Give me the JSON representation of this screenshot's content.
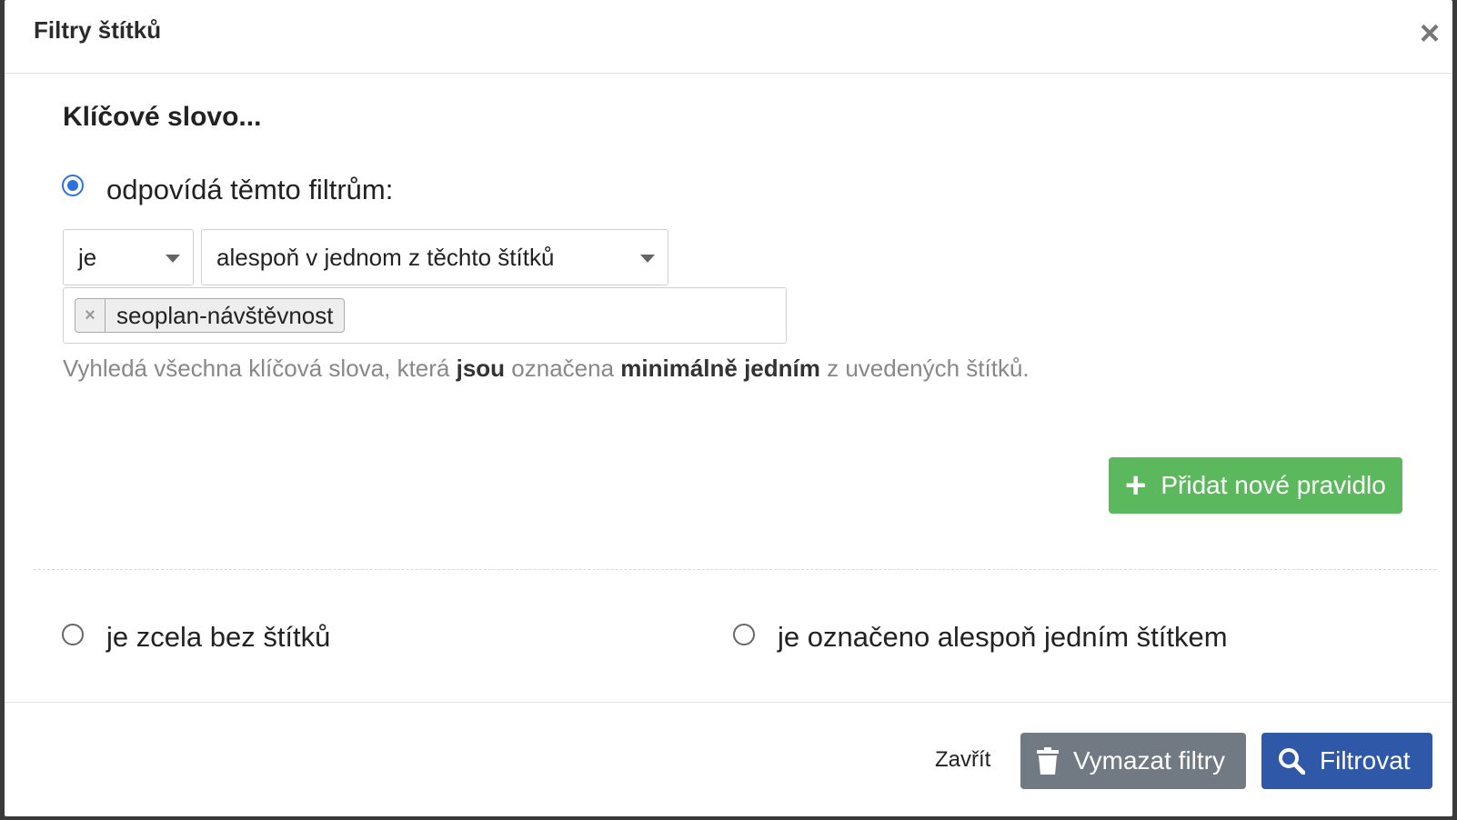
{
  "modal": {
    "title": "Filtry štítků",
    "close_icon": "close-icon"
  },
  "section": {
    "title": "Klíčové slovo..."
  },
  "options": {
    "match_filters": "odpovídá těmto filtrům:",
    "no_tags": "je zcela bez štítků",
    "any_tag": "je označeno alespoň jedním štítkem",
    "selected": "match_filters"
  },
  "rule": {
    "operator": "je",
    "condition": "alespoň v jednom z těchto štítků",
    "tags": [
      "seoplan-návštěvnost"
    ],
    "help": {
      "p1": "Vyhledá všechna klíčová slova, která ",
      "b1": "jsou",
      "p2": " označena ",
      "b2": "minimálně jedním",
      "p3": " z uvedených štítků."
    }
  },
  "buttons": {
    "add_rule": "Přidat nové pravidlo",
    "close": "Zavřít",
    "clear": "Vymazat filtry",
    "filter": "Filtrovat"
  },
  "colors": {
    "accent_radio": "#2f6fe0",
    "add_button": "#5cb85c",
    "clear_button": "#717a82",
    "filter_button": "#2f58a8"
  }
}
